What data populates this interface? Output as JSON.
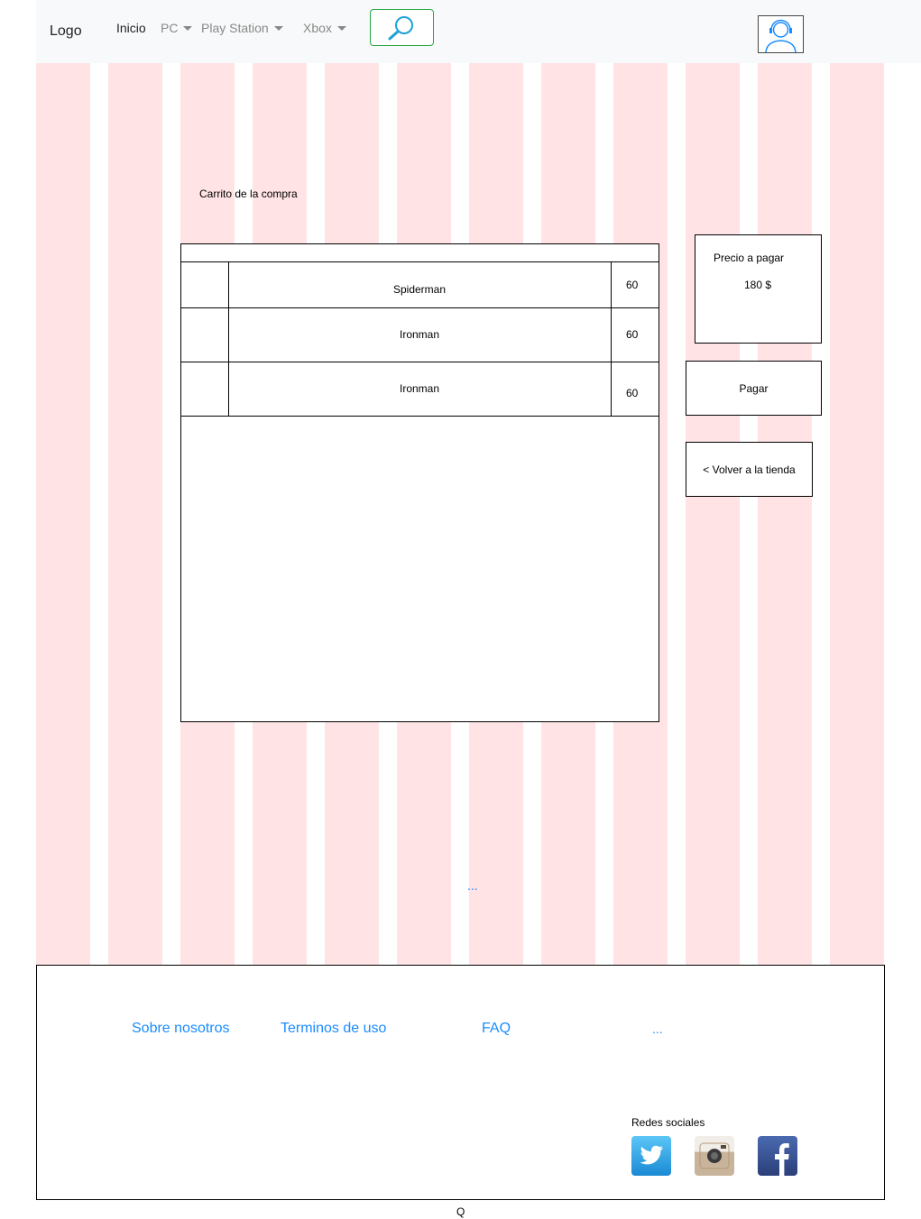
{
  "navbar": {
    "logo": "Logo",
    "inicio": "Inicio",
    "pc": "PC",
    "playstation": "Play Station",
    "xbox": "Xbox"
  },
  "cart": {
    "title": "Carrito de la compra",
    "items": [
      {
        "name": "Spiderman",
        "price": "60"
      },
      {
        "name": "Ironman",
        "price": "60"
      },
      {
        "name": "Ironman",
        "price": "60"
      }
    ]
  },
  "summary": {
    "label": "Precio a pagar",
    "total": "180 $"
  },
  "buttons": {
    "pay": "Pagar",
    "back": "< Volver a la tienda"
  },
  "ellipsis_main": "...",
  "footer": {
    "about": "Sobre nosotros",
    "terms": "Terminos de uso",
    "faq": "FAQ",
    "more": "...",
    "social_title": "Redes sociales",
    "social_icons": [
      "twitter-icon",
      "instagram-icon",
      "facebook-icon"
    ]
  },
  "bottom_char": "Q",
  "colors": {
    "grid_column": "#ffe3e5",
    "link": "#1a8cff",
    "search_border": "#28a745",
    "twitter": "#1da1f2",
    "facebook": "#3b5998"
  }
}
